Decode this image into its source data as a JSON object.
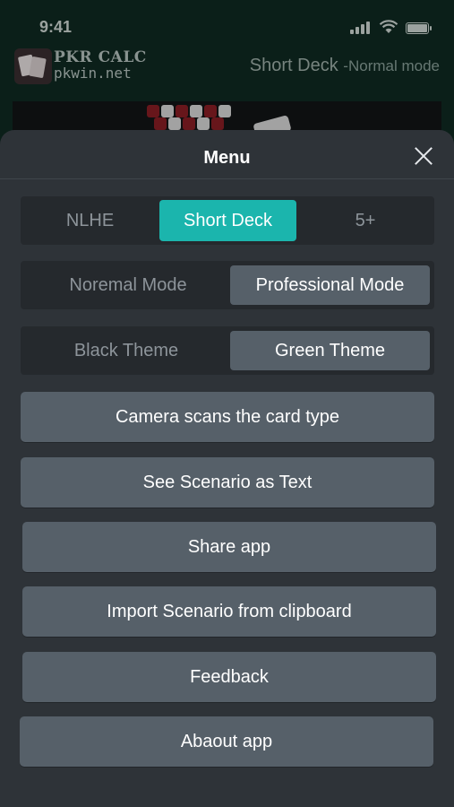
{
  "status_bar": {
    "time": "9:41"
  },
  "background": {
    "logo_title": "PKR CALC",
    "logo_subtitle": "pkwin.net",
    "header_title": "Short Deck",
    "header_mode": "-Normal mode"
  },
  "menu": {
    "title": "Menu",
    "game_types": [
      "NLHE",
      "Short Deck",
      "5+"
    ],
    "selected_game_type": "Short Deck",
    "modes": [
      "Noremal Mode",
      "Professional Mode"
    ],
    "selected_mode": "Professional Mode",
    "themes": [
      "Black Theme",
      "Green Theme"
    ],
    "selected_theme": "Green Theme",
    "actions": [
      "Camera scans the card type",
      "See Scenario as Text",
      "Share app",
      "Import Scenario from clipboard",
      "Feedback",
      "Abaout app"
    ]
  },
  "colors": {
    "accent_teal": "#1bb5ad",
    "sheet_bg": "#2e3338",
    "button_bg": "#566069",
    "segment_bg": "#25292d"
  },
  "icons": {
    "close": "close-icon",
    "signal": "signal-icon",
    "wifi": "wifi-icon",
    "battery": "battery-icon"
  }
}
